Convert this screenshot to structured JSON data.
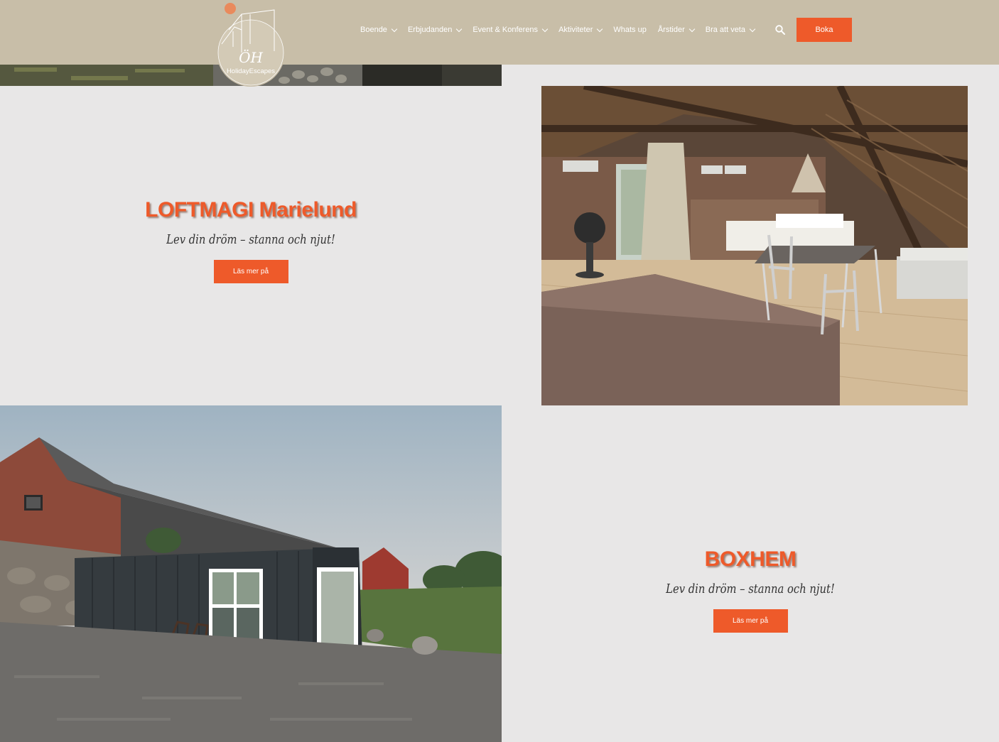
{
  "header": {
    "nav": [
      {
        "label": "Boende",
        "dropdown": true
      },
      {
        "label": "Erbjudanden",
        "dropdown": true
      },
      {
        "label": "Event & Konferens",
        "dropdown": true
      },
      {
        "label": "Aktiviteter",
        "dropdown": true
      },
      {
        "label": "Whats up",
        "dropdown": false
      },
      {
        "label": "Årstider",
        "dropdown": true
      },
      {
        "label": "Bra att veta",
        "dropdown": true
      }
    ],
    "book_label": "Boka",
    "logo_text": "HolidayEscapes",
    "logo_monogram": "ÖH"
  },
  "sections": {
    "loft": {
      "title": "LOFTMAGI Marielund",
      "tagline": "Lev din dröm – stanna och njut!",
      "cta": "Läs mer på"
    },
    "box": {
      "title": "BOXHEM",
      "tagline": "Lev din dröm – stanna och njut!",
      "cta": "Läs mer på"
    }
  },
  "colors": {
    "header_bg": "#c8bea8",
    "accent": "#ee5a2a",
    "page_bg": "#e8e7e7"
  }
}
